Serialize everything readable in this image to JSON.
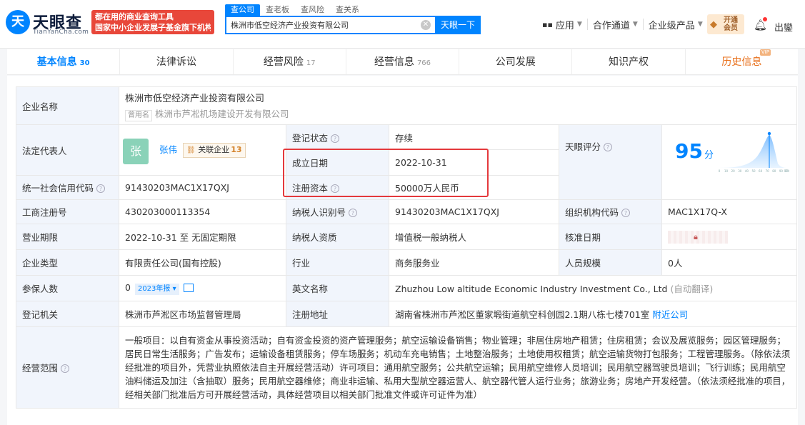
{
  "header": {
    "logo_text": "天眼查",
    "logo_sub": "TianYanCha.com",
    "slogan_line1": "都在用的商业查询工具",
    "slogan_line2": "国家中小企业发展子基金旗下机构",
    "search_tabs": [
      "查公司",
      "查老板",
      "查风险",
      "查关系"
    ],
    "search_value": "株洲市低空经济产业投资有限公司",
    "search_button": "天眼一下",
    "nav": [
      "应用",
      "合作通道",
      "企业级产品"
    ],
    "vip_line1": "开通",
    "vip_line2": "会员",
    "user": "出鑾"
  },
  "tabs": [
    {
      "label": "基本信息",
      "count": "30"
    },
    {
      "label": "法律诉讼",
      "count": ""
    },
    {
      "label": "经营风险",
      "count": "17"
    },
    {
      "label": "经营信息",
      "count": "766"
    },
    {
      "label": "公司发展",
      "count": ""
    },
    {
      "label": "知识产权",
      "count": ""
    },
    {
      "label": "历史信息",
      "count": "",
      "badge": "VIP"
    }
  ],
  "info": {
    "company_name_label": "企业名称",
    "company_name": "株洲市低空经济产业投资有限公司",
    "former_tag": "曾用名",
    "former_name": "株洲市芦凇机场建设开发有限公司",
    "legal_rep_label": "法定代表人",
    "legal_rep_avatar": "张",
    "legal_rep": "张伟",
    "related_label": "关联企业",
    "related_count": "13",
    "status_label": "登记状态",
    "status": "存续",
    "founded_label": "成立日期",
    "founded": "2022-10-31",
    "capital_label": "注册资本",
    "capital": "50000万人民币",
    "score_label": "天眼评分",
    "score": "95",
    "score_unit": "分",
    "paid_capital_label": "实缴资本",
    "paid_capital": "-",
    "credit_code_label": "统一社会信用代码",
    "credit_code": "91430203MAC1X17QXJ",
    "biz_reg_label": "工商注册号",
    "biz_reg": "430203000113354",
    "taxpayer_id_label": "纳税人识别号",
    "taxpayer_id": "91430203MAC1X17QXJ",
    "org_code_label": "组织机构代码",
    "org_code": "MAC1X17Q-X",
    "term_label": "营业期限",
    "term": "2022-10-31 至 无固定期限",
    "taxpayer_type_label": "纳税人资质",
    "taxpayer_type": "增值税一般纳税人",
    "approve_label": "核准日期",
    "type_label": "企业类型",
    "type": "有限责任公司(国有控股)",
    "industry_label": "行业",
    "industry": "商务服务业",
    "staff_label": "人员规模",
    "staff": "0人",
    "insured_label": "参保人数",
    "insured": "0",
    "insured_year": "2023年报",
    "en_name_label": "英文名称",
    "en_name": "Zhuzhou Low altitude Economic Industry Investment Co., Ltd",
    "auto_translate": "(自动翻译)",
    "authority_label": "登记机关",
    "authority": "株洲市芦淞区市场监督管理局",
    "address_label": "注册地址",
    "address": "湖南省株洲市芦淞区董家塅街道航空科创园2.1期八栋七楼701室",
    "nearby": "附近公司",
    "scope_label": "经营范围",
    "scope": "一般项目：以自有资金从事投资活动；自有资金投资的资产管理服务；航空运输设备销售；物业管理；非居住房地产租赁；住房租赁；会议及展览服务；园区管理服务；居民日常生活服务；广告发布；运输设备租赁服务；停车场服务；机动车充电销售；土地整治服务；土地使用权租赁；航空运输货物打包服务；工程管理服务。（除依法须经批准的项目外，凭营业执照依法自主开展经营活动）许可项目：通用航空服务；公共航空运输；民用航空维修人员培训；民用航空器驾驶员培训；飞行训练；民用航空油料储运及加注（含抽取）服务；民用航空器维修；商业非运输、私用大型航空器运营人、航空器代管人运行业务；旅游业务；房地产开发经营。（依法须经批准的项目，经相关部门批准后方可开展经营活动，具体经营项目以相关部门批准文件或许可证件为准）"
  },
  "colors": {
    "accent": "#0084ff",
    "label_bg": "#f1f5fc",
    "highlight": "#e4393c",
    "status": "#3aa36b"
  },
  "chart_data": {
    "type": "area",
    "x": [
      0,
      10,
      20,
      30,
      40,
      50,
      60,
      70,
      80,
      90,
      97,
      100
    ],
    "xlabel": "",
    "ylabel": "",
    "marker": 95
  }
}
